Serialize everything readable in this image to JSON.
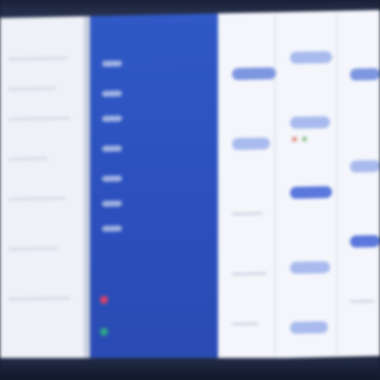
{
  "colors": {
    "sidebar": "#2b4fbd",
    "main_background": "#f4f6fb",
    "left_panel": "#eef1f7",
    "chip": "#7d96e0",
    "status_red": "#d6436a",
    "status_green": "#2ea58a"
  },
  "sidebar": {
    "items": [
      "",
      "",
      "",
      "",
      "",
      "",
      ""
    ]
  },
  "board": {
    "columns": 3
  }
}
